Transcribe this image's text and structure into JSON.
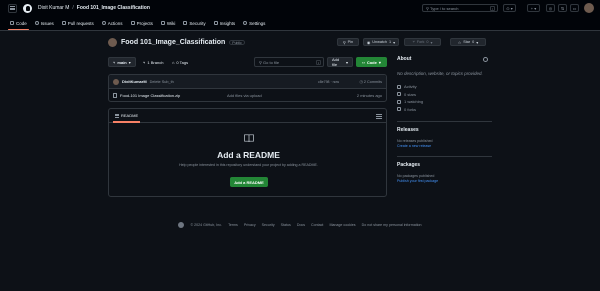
{
  "header": {
    "owner": "Dixit Kumar M",
    "separator": "/",
    "repo": "Food 101_Image Classification",
    "search_placeholder": "Type / to search",
    "search_key": "/",
    "plus_label": "+",
    "tabs": [
      {
        "label": "Code",
        "icon": "code-icon"
      },
      {
        "label": "Issues",
        "icon": "issue-icon"
      },
      {
        "label": "Pull requests",
        "icon": "pull-request-icon"
      },
      {
        "label": "Actions",
        "icon": "play-icon"
      },
      {
        "label": "Projects",
        "icon": "table-icon"
      },
      {
        "label": "Wiki",
        "icon": "book-icon"
      },
      {
        "label": "Security",
        "icon": "shield-icon"
      },
      {
        "label": "Insights",
        "icon": "graph-icon"
      },
      {
        "label": "Settings",
        "icon": "gear-icon"
      }
    ]
  },
  "repo_header": {
    "name": "Food 101_Image_Classification",
    "visibility": "Public",
    "pin_label": "Pin",
    "unwatch_label": "Unwatch",
    "unwatch_count": "1",
    "fork_label": "Fork",
    "fork_count": "0",
    "star_label": "Star",
    "star_count": "0"
  },
  "toolbar": {
    "branch": "main",
    "branches": "1 Branch",
    "tags": "0 Tags",
    "goto_placeholder": "Go to file",
    "goto_key": "t",
    "add_file": "Add file",
    "code": "Code"
  },
  "commit": {
    "author": "DixitKumarM",
    "message": "Delete Sub_th",
    "hash": "c8e798 · now",
    "count": "2 Commits"
  },
  "files": [
    {
      "name": "Food-101 Image Classification.zip",
      "message": "Add files via upload",
      "age": "2 minutes ago"
    }
  ],
  "readme": {
    "tab": "README",
    "title": "Add a README",
    "subtitle": "Help people interested in this repository understand your project by adding a README.",
    "button": "Add a README"
  },
  "about": {
    "title": "About",
    "description": "No description, website, or topics provided.",
    "items": [
      {
        "label": "Activity",
        "icon": "pulse-icon"
      },
      {
        "label": "0 stars",
        "icon": "star-icon"
      },
      {
        "label": "1 watching",
        "icon": "eye-icon"
      },
      {
        "label": "0 forks",
        "icon": "fork-icon"
      }
    ]
  },
  "releases": {
    "title": "Releases",
    "text": "No releases published",
    "link": "Create a new release"
  },
  "packages": {
    "title": "Packages",
    "text": "No packages published",
    "link": "Publish your first package"
  },
  "footer": {
    "copyright": "© 2024 GitHub, Inc.",
    "links": [
      "Terms",
      "Privacy",
      "Security",
      "Status",
      "Docs",
      "Contact",
      "Manage cookies",
      "Do not share my personal information"
    ]
  },
  "colors": {
    "bg": "#0d1117",
    "accent_green": "#238636",
    "tab_underline": "#f78166",
    "link": "#4493f8"
  }
}
